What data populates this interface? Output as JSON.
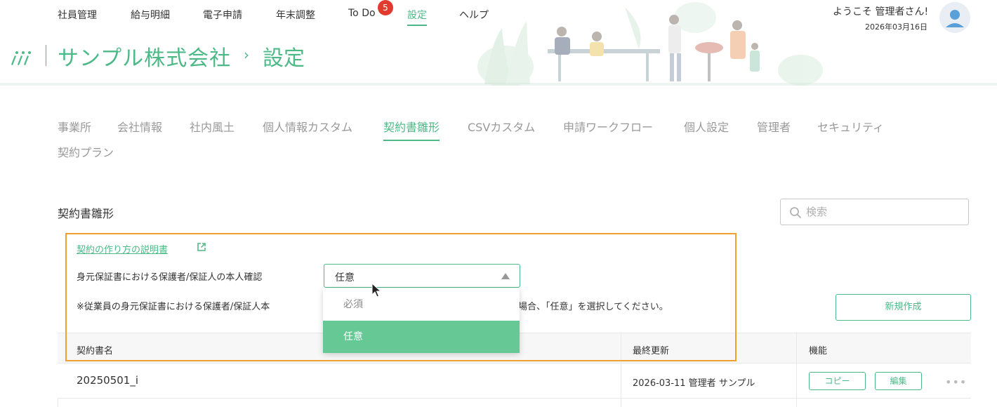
{
  "topnav": {
    "items": [
      {
        "label": "社員管理"
      },
      {
        "label": "給与明細"
      },
      {
        "label": "電子申請"
      },
      {
        "label": "年末調整"
      },
      {
        "label": "To Do"
      },
      {
        "label": "設定"
      },
      {
        "label": "ヘルプ"
      }
    ],
    "todo_badge": "5",
    "active": "設定"
  },
  "user": {
    "welcome": "ようこそ 管理者さん!",
    "date": "2026年03月16日"
  },
  "header": {
    "company": "サンプル株式会社",
    "separator": "›",
    "page": "設定"
  },
  "tabs": [
    {
      "label": "事業所"
    },
    {
      "label": "会社情報"
    },
    {
      "label": "社内風土"
    },
    {
      "label": "個人情報カスタム"
    },
    {
      "label": "契約書雛形"
    },
    {
      "label": "CSVカスタム"
    },
    {
      "label": "申請ワークフロー"
    },
    {
      "label": "個人設定"
    },
    {
      "label": "管理者"
    },
    {
      "label": "セキュリティ"
    },
    {
      "label": "契約プラン"
    }
  ],
  "active_tab": "契約書雛形",
  "section": {
    "title": "契約書雛形",
    "search_placeholder": "検索",
    "help_link": "契約の作り方の説明書",
    "field_label": "身元保証書における保護者/保証人の本人確認",
    "select_value": "任意",
    "options": [
      "必須",
      "任意"
    ],
    "note_left": "※従業員の身元保証書における保護者/保証人本",
    "note_right": "場合、「任意」を選択してください。",
    "new_button": "新規作成"
  },
  "table": {
    "headers": [
      "契約書名",
      "最終更新",
      "機能"
    ],
    "rows": [
      {
        "name": "20250501_i",
        "updated": "2026-03-11 管理者 サンプル",
        "copy": "コピー",
        "edit": "編集"
      }
    ]
  },
  "colors": {
    "accent": "#4cb987",
    "selected_option": "#66c894",
    "highlight": "#f0a030",
    "badge": "#e23a2e"
  }
}
